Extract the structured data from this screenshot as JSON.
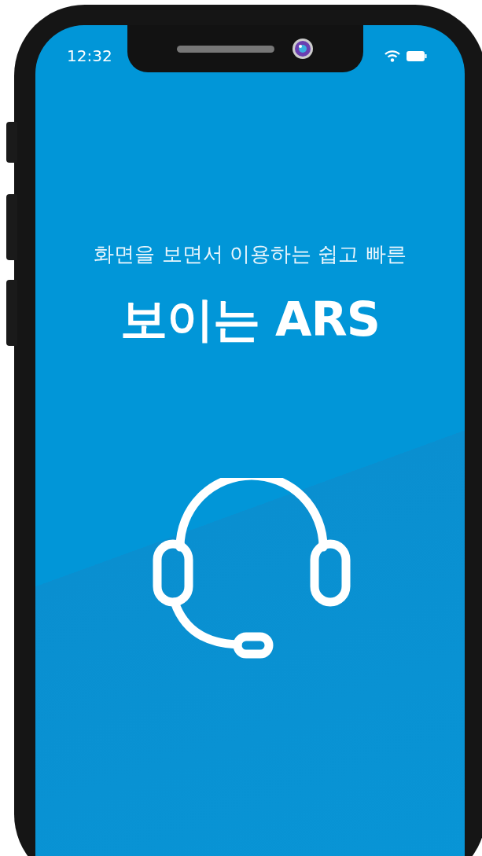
{
  "status_bar": {
    "time": "12:32"
  },
  "subtitle": "화면을 보면서 이용하는 쉽고 빠른",
  "title": "보이는 ARS"
}
